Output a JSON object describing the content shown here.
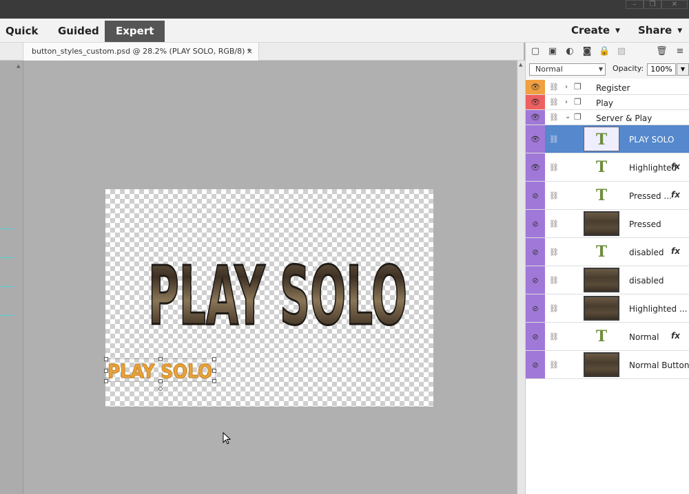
{
  "window": {
    "min_icon": "minimize-icon",
    "restore_icon": "restore-icon",
    "close_icon": "close-icon"
  },
  "modes": {
    "quick": "Quick",
    "guided": "Guided",
    "expert": "Expert"
  },
  "menu": {
    "create": "Create",
    "share": "Share"
  },
  "document_tab": {
    "title": "button_styles_custom.psd @ 28.2% (PLAY SOLO, RGB/8) *",
    "close": "×"
  },
  "canvas": {
    "main_text": "PLAY SOLO",
    "small_text": "PLAY SOLO",
    "main_text_color": "#4a3b2b",
    "small_text_color": "#e8a23a"
  },
  "layers_panel": {
    "blend_mode": "Normal",
    "opacity_label": "Opacity:",
    "opacity_value": "100%",
    "layers": [
      {
        "name": "Register",
        "type": "group",
        "expanded": false,
        "visible": true,
        "color": "#f0a040"
      },
      {
        "name": "Play",
        "type": "group",
        "expanded": false,
        "visible": true,
        "color": "#ee6060"
      },
      {
        "name": "Server & Play",
        "type": "group",
        "expanded": true,
        "visible": true,
        "color": "#a078d8"
      },
      {
        "name": "PLAY SOLO",
        "type": "text",
        "visible": true,
        "selected": true,
        "fx": false,
        "color": "#a078d8"
      },
      {
        "name": "Highlighted",
        "type": "text",
        "visible": true,
        "fx": true,
        "color": "#a078d8"
      },
      {
        "name": "Pressed ...",
        "type": "text",
        "visible": false,
        "fx": true,
        "color": "#a078d8"
      },
      {
        "name": "Pressed",
        "type": "image",
        "visible": false,
        "fx": false,
        "color": "#a078d8"
      },
      {
        "name": "disabled",
        "type": "text",
        "visible": false,
        "fx": true,
        "color": "#a078d8"
      },
      {
        "name": "disabled",
        "type": "image",
        "visible": false,
        "fx": false,
        "color": "#a078d8"
      },
      {
        "name": "Highlighted ...",
        "type": "image",
        "visible": false,
        "fx": false,
        "color": "#a078d8"
      },
      {
        "name": "Normal",
        "type": "text",
        "visible": false,
        "fx": true,
        "color": "#a078d8"
      },
      {
        "name": "Normal Button",
        "type": "image",
        "visible": false,
        "fx": false,
        "color": "#a078d8"
      }
    ],
    "fx_label": "fx",
    "text_thumb": "T"
  }
}
